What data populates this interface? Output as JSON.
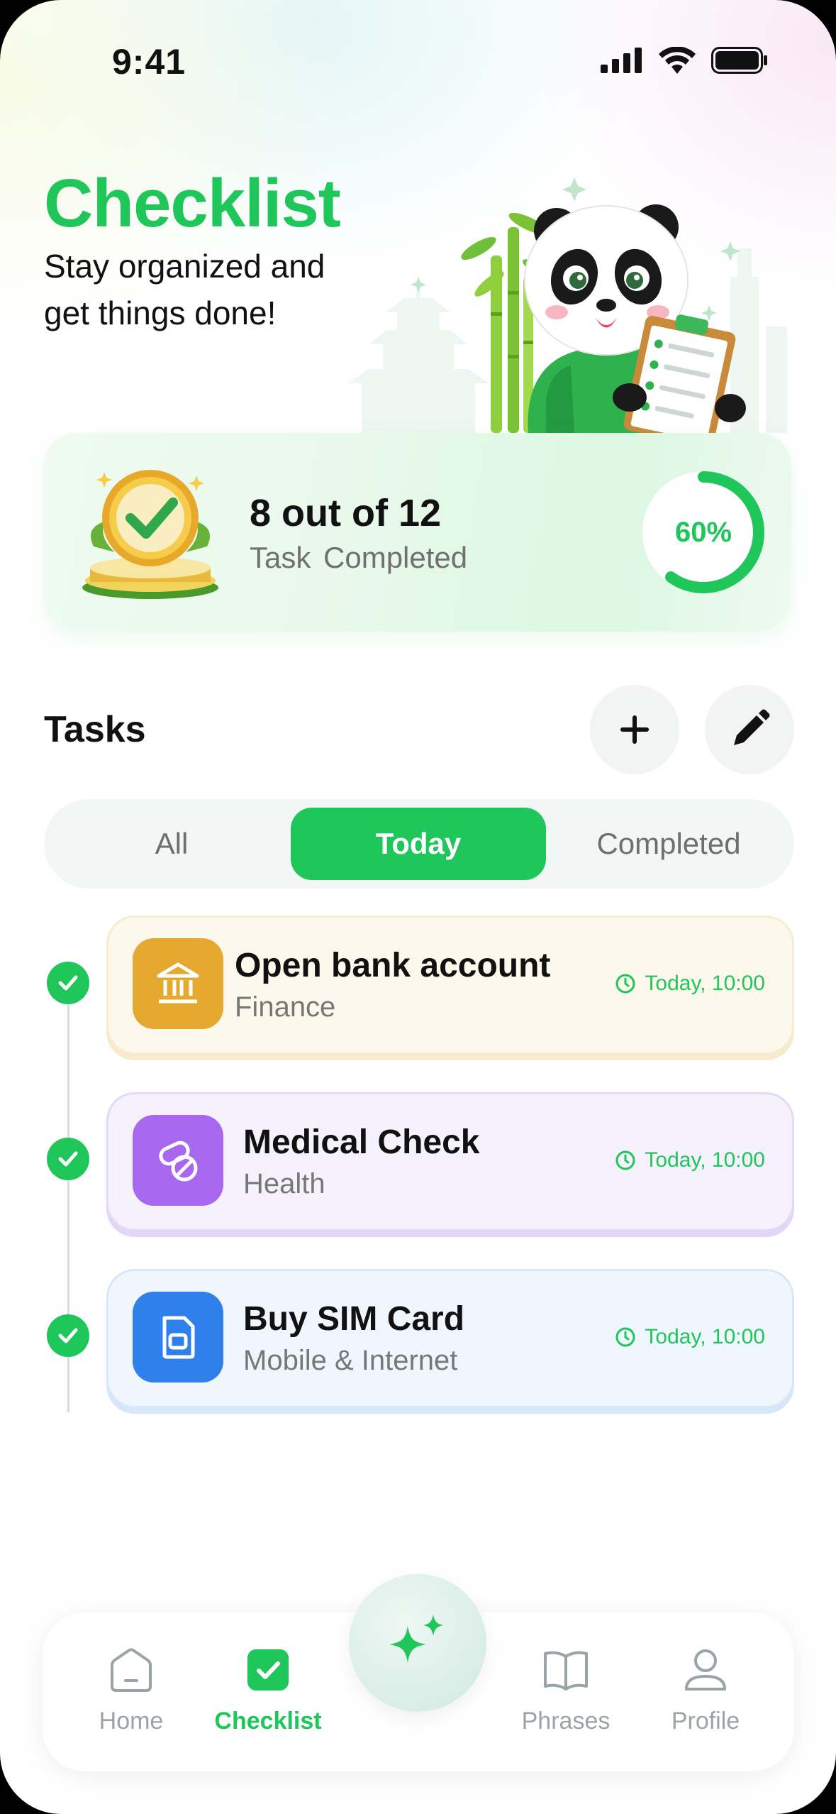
{
  "status_bar": {
    "time": "9:41"
  },
  "header": {
    "title": "Checklist",
    "subtitle": "Stay organized and get things done!"
  },
  "progress": {
    "count_text": "8 out of 12",
    "label": "Task Completed",
    "percent_text": "60%",
    "completed": 8,
    "total": 12,
    "percent": 60
  },
  "tasks_section": {
    "title": "Tasks",
    "add_icon": "plus-icon",
    "edit_icon": "pencil-icon"
  },
  "tabs": [
    {
      "label": "All",
      "active": false
    },
    {
      "label": "Today",
      "active": true
    },
    {
      "label": "Completed",
      "active": false
    }
  ],
  "tasks": [
    {
      "name": "Open bank account",
      "category": "Finance",
      "time": "Today, 10:00",
      "icon": "bank-icon",
      "color": "#e6a92f",
      "done": true
    },
    {
      "name": "Medical Check",
      "category": "Health",
      "time": "Today, 10:00",
      "icon": "pill-icon",
      "color": "#a867ef",
      "done": true
    },
    {
      "name": "Buy SIM Card",
      "category": "Mobile & Internet",
      "time": "Today, 10:00",
      "icon": "sim-card-icon",
      "color": "#2f80ea",
      "done": true
    }
  ],
  "bottom_nav": [
    {
      "label": "Home",
      "icon": "home-icon",
      "active": false
    },
    {
      "label": "Checklist",
      "icon": "checklist-icon",
      "active": true
    },
    {
      "label": "",
      "icon": "sparkle-icon",
      "active": false
    },
    {
      "label": "Phrases",
      "icon": "book-icon",
      "active": false
    },
    {
      "label": "Profile",
      "icon": "person-icon",
      "active": false
    }
  ],
  "colors": {
    "accent": "#1fc65a",
    "text": "#111111",
    "muted": "#707070"
  }
}
